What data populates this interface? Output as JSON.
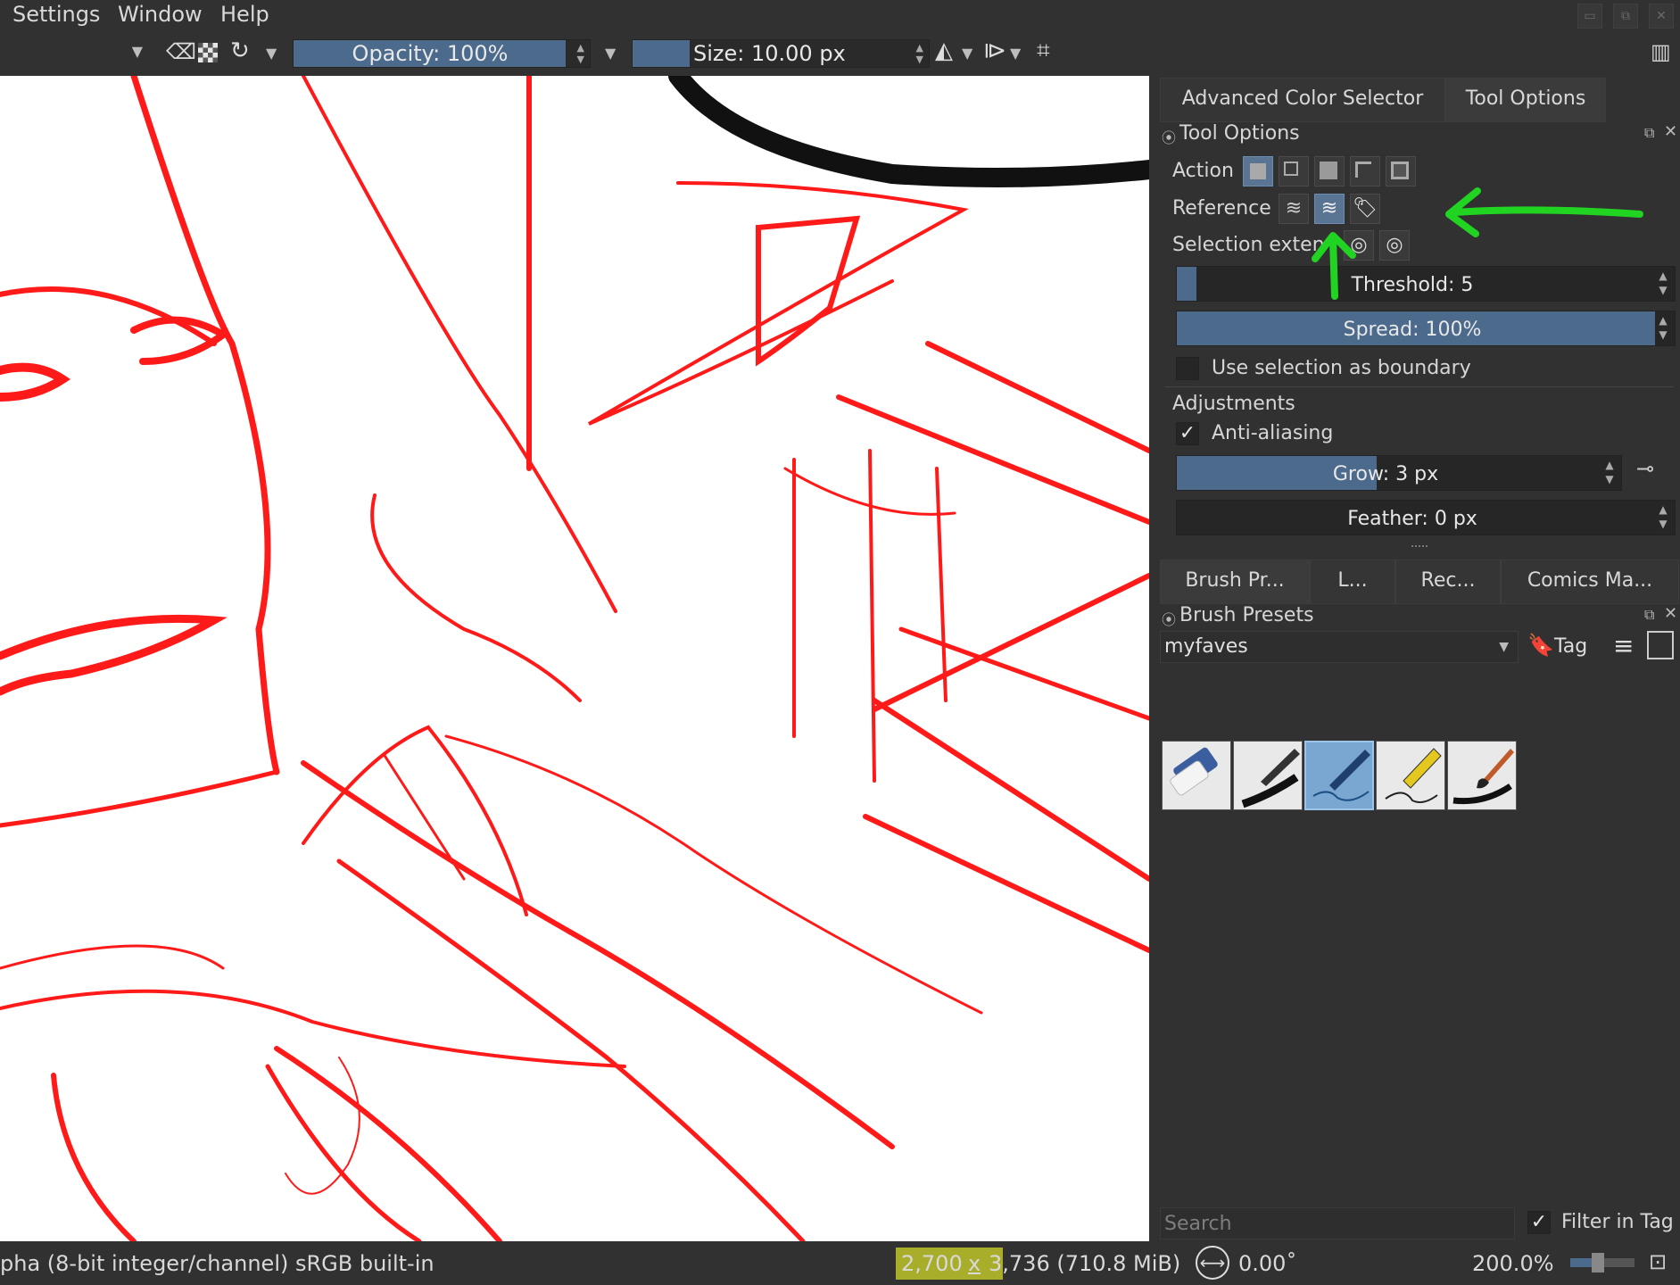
{
  "menu": {
    "settings": "Settings",
    "window": "Window",
    "help": "Help"
  },
  "toolbar": {
    "opacity_label": "Opacity: 100%",
    "opacity_percent": 100,
    "size_label": "Size: 10.00 px"
  },
  "docker_top": {
    "tabs": [
      "Advanced Color Selector",
      "Tool Options"
    ],
    "active_tab": "Tool Options",
    "panel_title": "Tool Options",
    "action_label": "Action",
    "reference_label": "Reference",
    "selection_extent_label": "Selection exten",
    "threshold_label": "Threshold: 5",
    "threshold_fraction": 0.04,
    "spread_label": "Spread: 100%",
    "spread_fraction": 1.0,
    "use_selection_label": "Use selection as boundary",
    "use_selection_checked": false,
    "adjustments_label": "Adjustments",
    "anti_aliasing_label": "Anti-aliasing",
    "anti_aliasing_checked": true,
    "grow_label": "Grow: 3 px",
    "grow_fraction": 0.5,
    "feather_label": "Feather: 0 px"
  },
  "docker_bottom": {
    "tabs": [
      "Brush Pr...",
      "L...",
      "Rec...",
      "Comics Ma..."
    ],
    "panel_title": "Brush Presets",
    "tag_value": "myfaves",
    "tag_button": "Tag",
    "search_placeholder": "Search",
    "filter_in_tag_label": "Filter in Tag",
    "filter_in_tag_checked": true,
    "presets": [
      "eraser",
      "ink-pen",
      "blue-pen",
      "fineliner",
      "brush"
    ],
    "selected_preset": "blue-pen"
  },
  "statusbar": {
    "color_info": "pha (8-bit integer/channel)  sRGB built-in",
    "dimensions_w": "2,700",
    "dimensions_x": "x",
    "dimensions_h": "3,736 (710.8 MiB)",
    "rotation": "0.00˚",
    "zoom": "200.0%"
  },
  "colors": {
    "accent_fill": "#4b6a8c",
    "sketch_red": "#ff1a1a",
    "annotation_green": "#22d422"
  }
}
